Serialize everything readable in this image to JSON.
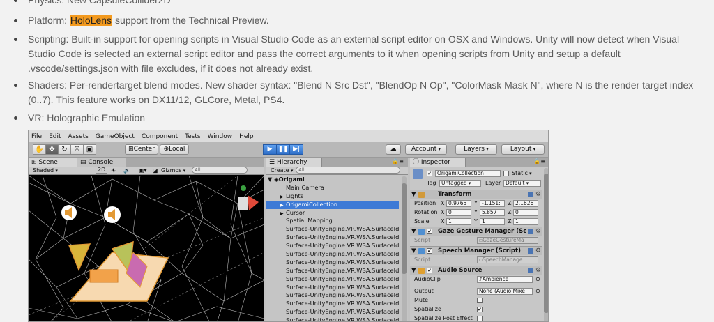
{
  "bullets": [
    {
      "text": "Physics: New CapsuleCollider2D"
    },
    {
      "before": "Platform: ",
      "highlight": "HoloLens",
      "after": " support from the Technical Preview."
    },
    {
      "text": "Scripting: Built-in support for opening scripts in Visual Studio Code as an external script editor on OSX and Windows. Unity will now detect when Visual Studio Code is selected an external script editor and pass the correct arguments to it when opening scripts from Unity and setup a default .vscode/settings.json with file excludes, if it does not already exist."
    },
    {
      "text": "Shaders: Per-rendertarget blend modes. New shader syntax: \"Blend N Src Dst\", \"BlendOp N Op\", \"ColorMask Mask N\", where N is the render target index (0..7). This feature works on DX11/12, GLCore, Metal, PS4."
    },
    {
      "text": "VR: Holographic Emulation"
    }
  ],
  "unity": {
    "menu": [
      "File",
      "Edit",
      "Assets",
      "GameObject",
      "Component",
      "Tests",
      "Window",
      "Help"
    ],
    "toolbar": {
      "pivot": "Center",
      "space": "Local",
      "account": "Account",
      "layers": "Layers",
      "layout": "Layout"
    },
    "scene": {
      "tab_scene": "Scene",
      "tab_console": "Console",
      "shading": "Shaded",
      "mode_2d": "2D",
      "gizmos": "Gizmos",
      "search_placeholder": "All"
    },
    "hierarchy": {
      "tab": "Hierarchy",
      "create": "Create",
      "search_placeholder": "All",
      "root": "Origami",
      "items": [
        {
          "label": "Main Camera",
          "indent": 1,
          "arrow": "",
          "selected": false
        },
        {
          "label": "Lights",
          "indent": 1,
          "arrow": "▶",
          "selected": false
        },
        {
          "label": "OrigamiCollection",
          "indent": 1,
          "arrow": "▶",
          "selected": true
        },
        {
          "label": "Cursor",
          "indent": 1,
          "arrow": "▶",
          "selected": false
        },
        {
          "label": "Spatial Mapping",
          "indent": 1,
          "arrow": "",
          "selected": false
        },
        {
          "label": "Surface-UnityEngine.VR.WSA.SurfaceId",
          "indent": 1,
          "arrow": "",
          "selected": false
        },
        {
          "label": "Surface-UnityEngine.VR.WSA.SurfaceId",
          "indent": 1,
          "arrow": "",
          "selected": false
        },
        {
          "label": "Surface-UnityEngine.VR.WSA.SurfaceId",
          "indent": 1,
          "arrow": "",
          "selected": false
        },
        {
          "label": "Surface-UnityEngine.VR.WSA.SurfaceId",
          "indent": 1,
          "arrow": "",
          "selected": false
        },
        {
          "label": "Surface-UnityEngine.VR.WSA.SurfaceId",
          "indent": 1,
          "arrow": "",
          "selected": false
        },
        {
          "label": "Surface-UnityEngine.VR.WSA.SurfaceId",
          "indent": 1,
          "arrow": "",
          "selected": false
        },
        {
          "label": "Surface-UnityEngine.VR.WSA.SurfaceId",
          "indent": 1,
          "arrow": "",
          "selected": false
        },
        {
          "label": "Surface-UnityEngine.VR.WSA.SurfaceId",
          "indent": 1,
          "arrow": "",
          "selected": false
        },
        {
          "label": "Surface-UnityEngine.VR.WSA.SurfaceId",
          "indent": 1,
          "arrow": "",
          "selected": false
        },
        {
          "label": "Surface-UnityEngine.VR.WSA.SurfaceId",
          "indent": 1,
          "arrow": "",
          "selected": false
        },
        {
          "label": "Surface-UnityEngine.VR.WSA.SurfaceId",
          "indent": 1,
          "arrow": "",
          "selected": false
        },
        {
          "label": "Surface-UnityEngine.VR.WSA.SurfaceId",
          "indent": 1,
          "arrow": "",
          "selected": false
        },
        {
          "label": "Surface-UnityEngine.VR.WSA.SurfaceId",
          "indent": 1,
          "arrow": "",
          "selected": false
        }
      ]
    },
    "inspector": {
      "tab": "Inspector",
      "object_name": "OrigamiCollection",
      "static_label": "Static",
      "tag_label": "Tag",
      "tag_value": "Untagged",
      "layer_label": "Layer",
      "layer_value": "Default",
      "transform": {
        "title": "Transform",
        "position_label": "Position",
        "rotation_label": "Rotation",
        "scale_label": "Scale",
        "position": [
          "0.9765",
          "-1.151:",
          "2.1626"
        ],
        "rotation": [
          "0",
          "5.857",
          "0"
        ],
        "scale": [
          "1",
          "1",
          "1"
        ]
      },
      "gaze": {
        "title": "Gaze Gesture Manager (Sc",
        "script_label": "Script",
        "script_value": "GazeGestureMa"
      },
      "speech": {
        "title": "Speech Manager (Script)",
        "script_label": "Script",
        "script_value": "SpeechManage"
      },
      "audio": {
        "title": "Audio Source",
        "clip_label": "AudioClip",
        "clip_value": "Ambience",
        "output_label": "Output",
        "output_value": "None (Audio Mixe",
        "mute_label": "Mute",
        "spatialize_label": "Spatialize",
        "spatialize_post_label": "Spatialize Post Effect"
      }
    }
  }
}
